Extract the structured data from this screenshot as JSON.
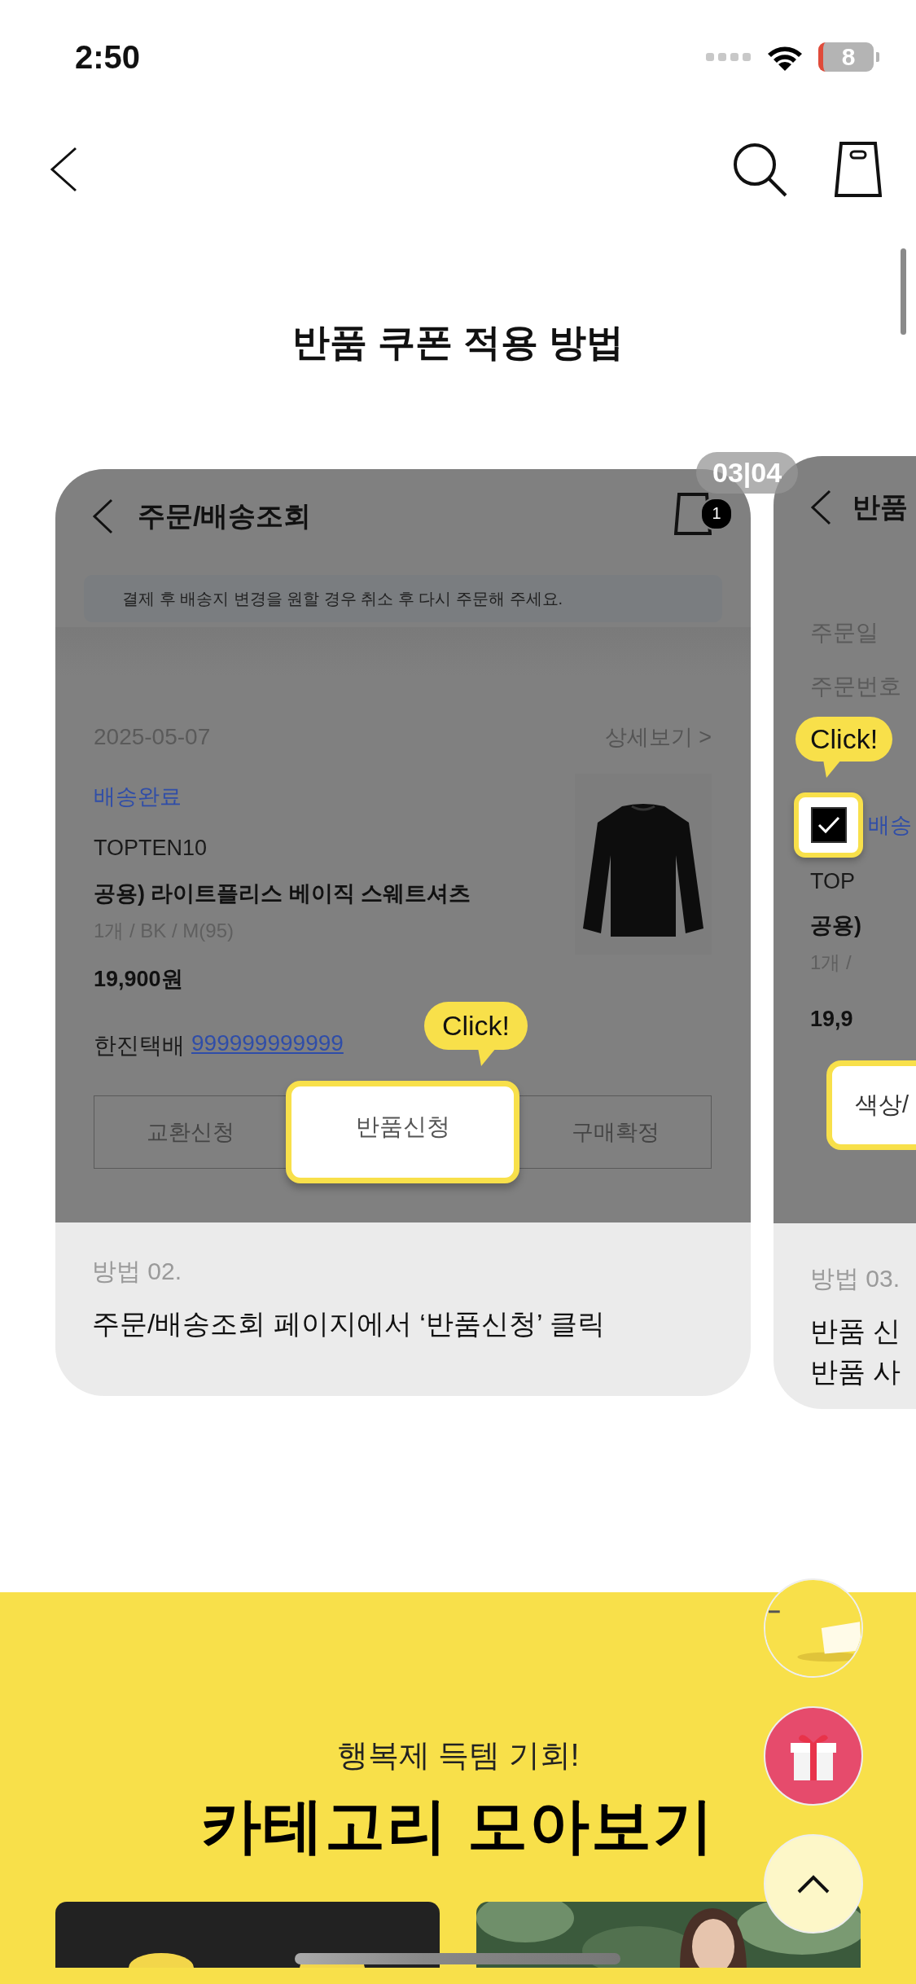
{
  "status_bar": {
    "time": "2:50",
    "battery": "8"
  },
  "page_title": "반품 쿠폰 적용 방법",
  "carousel": {
    "counter": "03|04",
    "slides": [
      {
        "kind": "order_list",
        "header_title": "주문/배송조회",
        "cart_badge": "1",
        "notice": "결제 후 배송지 변경을 원할 경우 취소 후 다시 주문해 주세요.",
        "date": "2025-05-07",
        "detail_link": "상세보기 >",
        "status": "배송완료",
        "brand": "TOPTEN10",
        "product": "공용) 라이트플리스 베이직 스웨트셔츠",
        "options": "1개 / BK / M(95)",
        "price": "19,900원",
        "courier": "한진택배",
        "tracking": "999999999999",
        "callout": "Click!",
        "buttons": [
          {
            "label": "교환신청",
            "highlighted": false
          },
          {
            "label": "반품신청",
            "highlighted": true
          },
          {
            "label": "구매확정",
            "highlighted": false
          }
        ],
        "step": "방법 02.",
        "caption_lines": [
          "주문/배송조회 페이지에서 ‘반품신청’ 클릭"
        ]
      },
      {
        "kind": "return_form",
        "header_title": "반품",
        "fields": [
          "주문일",
          "주문번호"
        ],
        "callout": "Click!",
        "checked": true,
        "status": "배송",
        "brand": "TOP",
        "product": "공용)",
        "options": "1개 /",
        "price": "19,9",
        "option_button": "색상/",
        "step": "방법 03.",
        "caption_lines": [
          "반품 신",
          "반품 사"
        ]
      }
    ]
  },
  "promo": {
    "subtitle": "행복제 득템 기회!",
    "title": "카테고리 모아보기"
  }
}
